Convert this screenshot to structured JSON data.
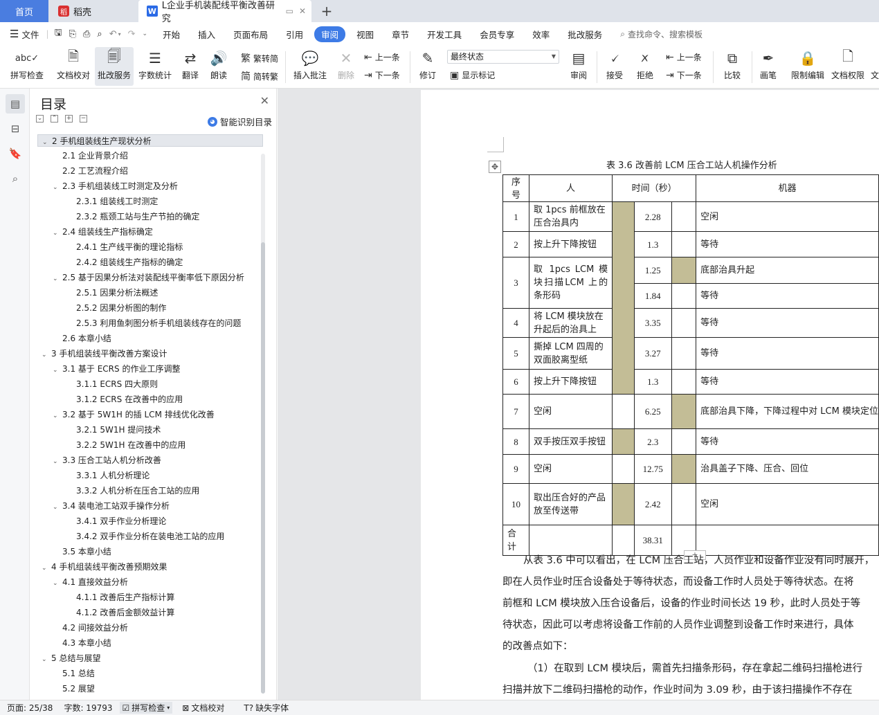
{
  "tabs": {
    "home": "首页",
    "daoke": "稻壳",
    "doc": "L企业手机装配线平衡改善研究",
    "add": "+"
  },
  "menu": {
    "file": "文件",
    "items": [
      "开始",
      "插入",
      "页面布局",
      "引用",
      "审阅",
      "视图",
      "章节",
      "开发工具",
      "会员专享",
      "效率",
      "批改服务"
    ],
    "active": "审阅",
    "search": "查找命令、搜索模板"
  },
  "ribbon": {
    "spell_check": "拼写检查",
    "doc_proof": "文档校对",
    "correction_service": "批改服务",
    "word_count": "字数统计",
    "translate": "翻译",
    "read_aloud": "朗读",
    "trad_to_simp": "繁转简",
    "simp_to_trad": "简转繁",
    "insert_comment": "插入批注",
    "delete": "删除",
    "prev_comment": "上一条",
    "next_comment": "下一条",
    "revise": "修订",
    "status_select": "最终状态",
    "show_markup": "显示标记",
    "review": "审阅",
    "accept": "接受",
    "reject": "拒绝",
    "prev_change": "上一条",
    "next_change": "下一条",
    "compare": "比较",
    "pen": "画笔",
    "restrict_edit": "限制编辑",
    "doc_permission": "文档权限",
    "cut_off": "文"
  },
  "panel": {
    "title": "目录",
    "ai_toc": "智能识别目录"
  },
  "toc": [
    {
      "text": "2 手机组装线生产现状分析",
      "level": 0,
      "caret": true
    },
    {
      "text": "2.1 企业背景介绍",
      "level": 1,
      "caret": false
    },
    {
      "text": "2.2 工艺流程介绍",
      "level": 1,
      "caret": false
    },
    {
      "text": "2.3 手机组装线工时测定及分析",
      "level": 1,
      "caret": true
    },
    {
      "text": "2.3.1 组装线工时测定",
      "level": 2,
      "caret": false
    },
    {
      "text": "2.3.2 瓶颈工站与生产节拍的确定",
      "level": 2,
      "caret": false
    },
    {
      "text": "2.4 组装线生产指标确定",
      "level": 1,
      "caret": true
    },
    {
      "text": "2.4.1 生产线平衡的理论指标",
      "level": 2,
      "caret": false
    },
    {
      "text": "2.4.2 组装线生产指标的确定",
      "level": 2,
      "caret": false
    },
    {
      "text": "2.5 基于因果分析法对装配线平衡率低下原因分析",
      "level": 1,
      "caret": true
    },
    {
      "text": "2.5.1 因果分析法概述",
      "level": 2,
      "caret": false
    },
    {
      "text": "2.5.2 因果分析图的制作",
      "level": 2,
      "caret": false
    },
    {
      "text": "2.5.3 利用鱼刺图分析手机组装线存在的问题",
      "level": 2,
      "caret": false
    },
    {
      "text": "2.6 本章小结",
      "level": 1,
      "caret": false
    },
    {
      "text": "3 手机组装线平衡改善方案设计",
      "level": 0,
      "caret": true
    },
    {
      "text": "3.1 基于 ECRS 的作业工序调整",
      "level": 1,
      "caret": true
    },
    {
      "text": "3.1.1 ECRS 四大原则",
      "level": 2,
      "caret": false
    },
    {
      "text": "3.1.2 ECRS 在改善中的应用",
      "level": 2,
      "caret": false
    },
    {
      "text": "3.2 基于 5W1H 的插 LCM 排线优化改善",
      "level": 1,
      "caret": true
    },
    {
      "text": "3.2.1 5W1H 提问技术",
      "level": 2,
      "caret": false
    },
    {
      "text": "3.2.2 5W1H 在改善中的应用",
      "level": 2,
      "caret": false
    },
    {
      "text": "3.3 压合工站人机分析改善",
      "level": 1,
      "caret": true
    },
    {
      "text": "3.3.1 人机分析理论",
      "level": 2,
      "caret": false
    },
    {
      "text": "3.3.2 人机分析在压合工站的应用",
      "level": 2,
      "caret": false
    },
    {
      "text": "3.4 装电池工站双手操作分析",
      "level": 1,
      "caret": true
    },
    {
      "text": "3.4.1 双手作业分析理论",
      "level": 2,
      "caret": false
    },
    {
      "text": "3.4.2 双手作业分析在装电池工站的应用",
      "level": 2,
      "caret": false
    },
    {
      "text": "3.5 本章小结",
      "level": 1,
      "caret": false
    },
    {
      "text": "4 手机组装线平衡改善预期效果",
      "level": 0,
      "caret": true
    },
    {
      "text": "4.1 直接效益分析",
      "level": 1,
      "caret": true
    },
    {
      "text": "4.1.1 改善后生产指标计算",
      "level": 2,
      "caret": false
    },
    {
      "text": "4.1.2 改善后金额效益计算",
      "level": 2,
      "caret": false
    },
    {
      "text": "4.2 间接效益分析",
      "level": 1,
      "caret": false
    },
    {
      "text": "4.3 本章小结",
      "level": 1,
      "caret": false
    },
    {
      "text": "5 总结与展望",
      "level": 0,
      "caret": true
    },
    {
      "text": "5.1 总结",
      "level": 1,
      "caret": false
    },
    {
      "text": "5.2 展望",
      "level": 1,
      "caret": false
    }
  ],
  "table": {
    "caption": "表 3.6 改善前 LCM 压合工站人机操作分析",
    "headers": {
      "seq": "序号",
      "person": "人",
      "time": "时间（秒）",
      "machine": "机器"
    },
    "rows": [
      {
        "seq": "1",
        "person": "取 1pcs 前框放在压合治具内",
        "t1": "2.28",
        "machine": "空闲"
      },
      {
        "seq": "2",
        "person": "按上升下降按钮",
        "t1": "1.3",
        "machine": "等待"
      },
      {
        "seq": "3",
        "person": "取 1pcs LCM 模块扫描LCM 上的条形码",
        "t1": "1.25",
        "machine": "底部治具升起",
        "t1b": "1.84",
        "machine_b": "等待"
      },
      {
        "seq": "4",
        "person": "将 LCM 模块放在升起后的治具上",
        "t1": "3.35",
        "machine": "等待"
      },
      {
        "seq": "5",
        "person": "撕掉 LCM 四周的双面胶离型纸",
        "t1": "3.27",
        "machine": "等待"
      },
      {
        "seq": "6",
        "person": "按上升下降按钮",
        "t1": "1.3",
        "machine": "等待"
      },
      {
        "seq": "7",
        "person": "空闲",
        "t1": "6.25",
        "machine": "底部治具下降，下降过程中对 LCM 模块定位"
      },
      {
        "seq": "8",
        "person": "双手按压双手按钮",
        "t1": "2.3",
        "machine": "等待"
      },
      {
        "seq": "9",
        "person": "空闲",
        "t1": "12.75",
        "machine": "治具盖子下降、压合、回位"
      },
      {
        "seq": "10",
        "person": "取出压合好的产品放至传送带",
        "t1": "2.42",
        "machine": "空闲"
      },
      {
        "seq": "合计",
        "person": "",
        "t1": "38.31",
        "machine": ""
      }
    ]
  },
  "body_text": [
    "从表 3.6 中可以看出，在 LCM 压合工站，人员作业和设备作业没有同时展开，",
    "即在人员作业时压合设备处于等待状态，而设备工作时人员处于等待状态。在将",
    "前框和 LCM 模块放入压合设备后，设备的作业时间长达 19 秒，此时人员处于等",
    "待状态，因此可以考虑将设备工作前的人员作业调整到设备工作时来进行，具体",
    "的改善点如下：",
    "（1）在取到 LCM 模块后，需首先扫描条形码，存在拿起二维码扫描枪进行",
    "扫描并放下二维码扫描枪的动作，作业时间为 3.09 秒，由于该扫描操作不存在"
  ],
  "status": {
    "page": "页面: 25/38",
    "words": "字数: 19793",
    "spell": "拼写检查",
    "proof": "文档校对",
    "missing_font": "缺失字体"
  }
}
